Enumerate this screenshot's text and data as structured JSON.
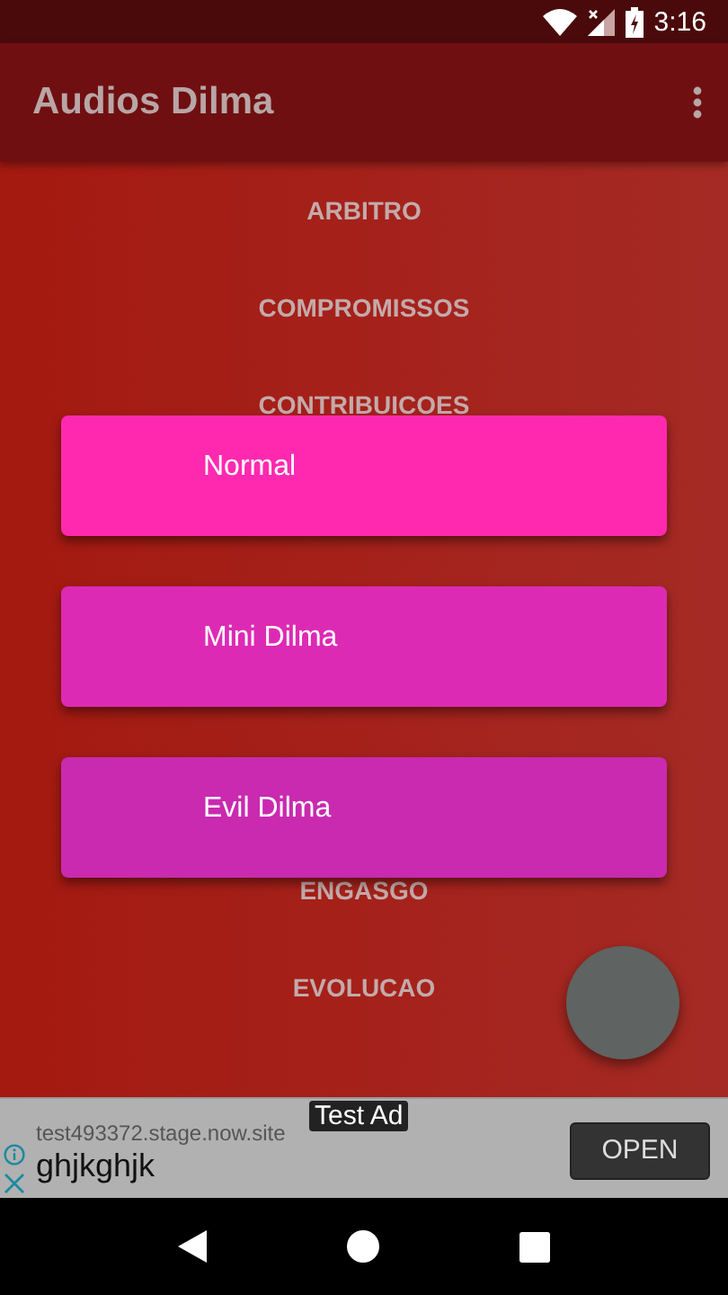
{
  "status_bar": {
    "time": "3:16"
  },
  "toolbar": {
    "title": "Audios Dilma"
  },
  "list": {
    "items_above": [
      "ARBITRO",
      "COMPROMISSOS",
      "CONTRIBUICOES"
    ],
    "items_below": [
      "ENGASGO",
      "EVOLUCAO"
    ]
  },
  "options": [
    {
      "label": "Normal",
      "color": "#ff29b0"
    },
    {
      "label": "Mini Dilma",
      "color": "#dd2ab5"
    },
    {
      "label": "Evil Dilma",
      "color": "#c92ab0"
    }
  ],
  "ad": {
    "url": "test493372.stage.now.site",
    "headline": "ghjkghjk",
    "badge": "Test Ad",
    "button": "OPEN"
  }
}
